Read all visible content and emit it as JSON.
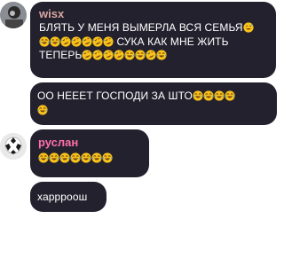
{
  "messages": [
    {
      "author": "wisx",
      "author_color": "#d8a7a0",
      "lines": [
        {
          "text": "БЛЯТЬ У МЕНЯ ВЫМЕРЛА ВСЯ СЕМЬЯ"
        },
        {
          "text": "СУКА КАК МНЕ ЖИТЬ"
        },
        {
          "text": "ТЕПЕРЬ"
        }
      ],
      "emoji_names": [
        "sweat-smile-emoji",
        "joy-emoji",
        "rofl-emoji"
      ]
    },
    {
      "author": "",
      "lines": [
        {
          "text": "ОО НЕЕЕТ ГОСПОДИ ЗА ШТО"
        }
      ]
    },
    {
      "author": "руслан",
      "author_color": "#ff6fa8",
      "lines": []
    },
    {
      "author": "",
      "lines": [
        {
          "text": "харрроош"
        }
      ]
    }
  ],
  "colors": {
    "bubble_bg": "#24212e",
    "page_bg": "#ffffff",
    "emoji_face": "#f7c21b",
    "emoji_tear": "#3fa7f2"
  }
}
